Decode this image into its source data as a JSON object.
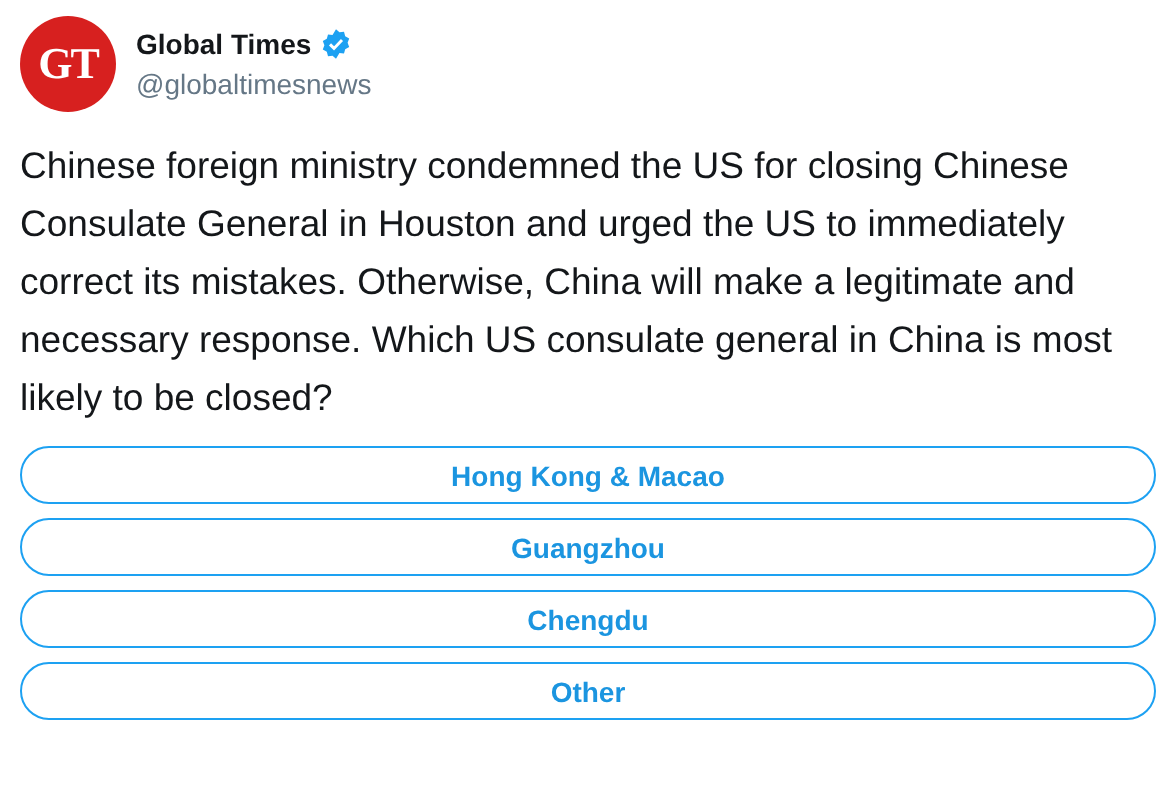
{
  "account": {
    "logo": "GT",
    "name": "Global Times",
    "verified": true,
    "handle": "@globaltimesnews"
  },
  "tweet": {
    "text": "Chinese foreign ministry condemned the US for closing Chinese Consulate General in Houston and urged the US to immediately correct its mistakes. Otherwise, China will make a legitimate and necessary response. Which US consulate general in China is most likely to be closed?"
  },
  "poll": {
    "options": [
      {
        "label": "Hong Kong & Macao"
      },
      {
        "label": "Guangzhou"
      },
      {
        "label": "Chengdu"
      },
      {
        "label": "Other"
      }
    ]
  }
}
